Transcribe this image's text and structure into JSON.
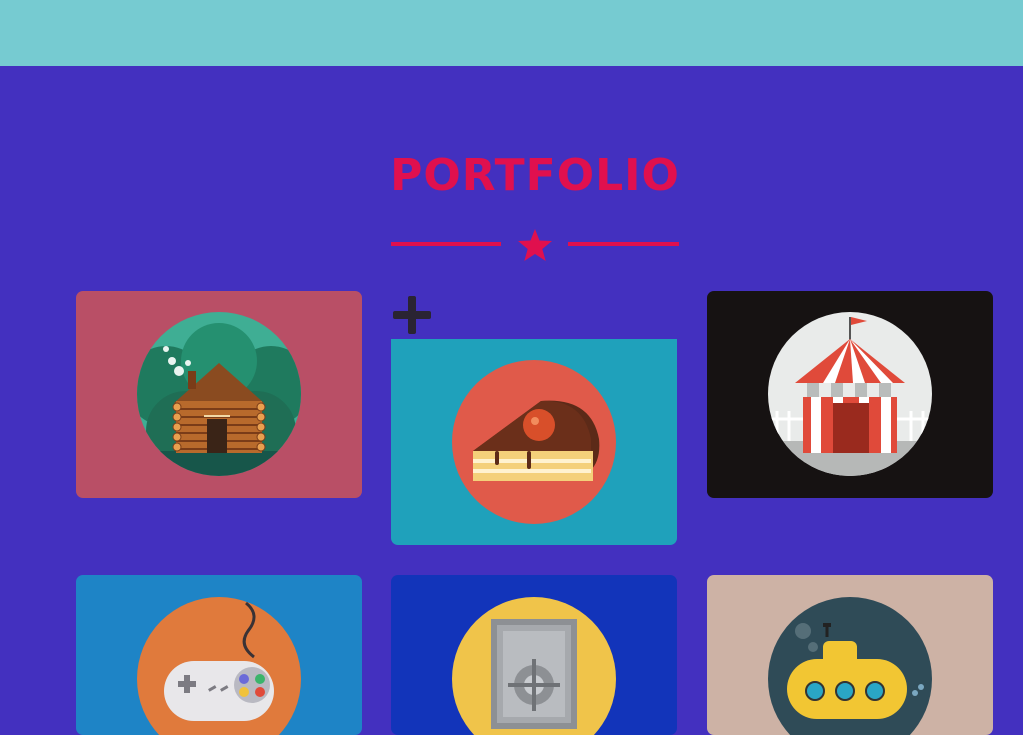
{
  "header": {
    "bar_color": "#76cbd1"
  },
  "portfolio": {
    "title": "PORTFOLIO",
    "accent": "#e0104e",
    "background": "#4330bf",
    "items": [
      {
        "icon": "log-cabin-icon",
        "bg": "#b94f66"
      },
      {
        "icon": "cake-slice-icon",
        "bg": "#1fa1bb",
        "hovered": true
      },
      {
        "icon": "circus-tent-icon",
        "bg": "#161212"
      },
      {
        "icon": "game-controller-icon",
        "bg": "#1e84c6"
      },
      {
        "icon": "safe-icon",
        "bg": "#1234ba"
      },
      {
        "icon": "submarine-icon",
        "bg": "#cdb2a5"
      }
    ]
  }
}
